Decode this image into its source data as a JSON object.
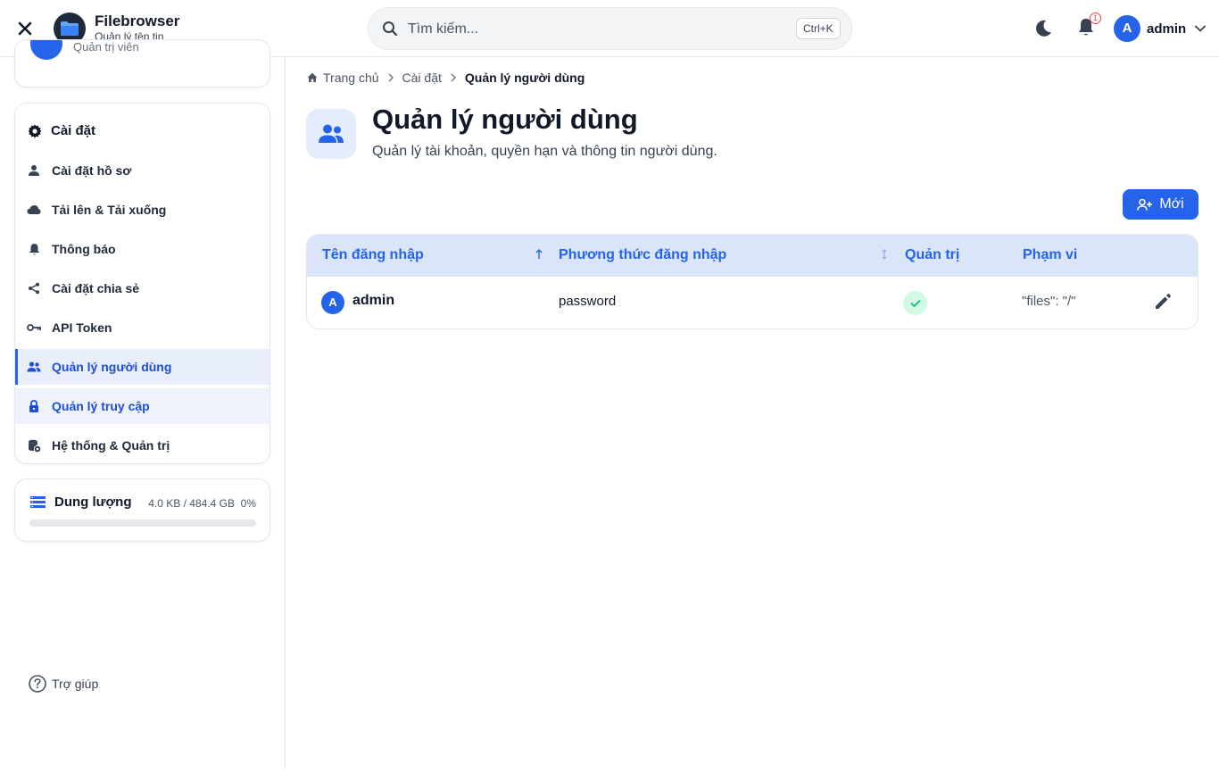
{
  "header": {
    "app_name": "Filebrowser",
    "app_subtitle": "Quản lý tệp tin",
    "search_placeholder": "Tìm kiếm...",
    "search_shortcut": "Ctrl+K",
    "notification_count": "1",
    "user_initial": "A",
    "user_name": "admin"
  },
  "sidebar": {
    "profile_role": "Quản trị viên",
    "settings_title": "Cài đặt",
    "items": [
      {
        "label": "Cài đặt hồ sơ",
        "icon": "user-icon"
      },
      {
        "label": "Tải lên & Tải xuống",
        "icon": "cloud-icon"
      },
      {
        "label": "Thông báo",
        "icon": "bell-icon"
      },
      {
        "label": "Cài đặt chia sẻ",
        "icon": "share-icon"
      },
      {
        "label": "API Token",
        "icon": "key-icon"
      },
      {
        "label": "Quản lý người dùng",
        "icon": "users-icon",
        "active": true
      },
      {
        "label": "Quản lý truy cập",
        "icon": "lock-icon",
        "hover": true
      },
      {
        "label": "Hệ thống & Quản trị",
        "icon": "database-gear-icon"
      }
    ],
    "storage": {
      "label": "Dung lượng",
      "value": "4.0 KB / 484.4 GB",
      "percent": "0%",
      "fill_fraction": 0
    },
    "help_label": "Trợ giúp"
  },
  "main": {
    "breadcrumb": {
      "home": "Trang chủ",
      "settings": "Cài đặt",
      "current": "Quản lý người dùng"
    },
    "title": "Quản lý người dùng",
    "subtitle": "Quản lý tài khoản, quyền hạn và thông tin người dùng.",
    "new_button": "Mới",
    "table": {
      "columns": [
        "Tên đăng nhập",
        "Phương thức đăng nhập",
        "Quản trị",
        "Phạm vi"
      ],
      "rows": [
        {
          "initial": "A",
          "username": "admin",
          "method": "password",
          "admin": true,
          "scope": "\"files\": \"/\""
        }
      ]
    }
  },
  "colors": {
    "accent": "#2563eb",
    "active_bg": "#e8eefc",
    "table_header_bg": "#dbe5fa",
    "success_bg": "#d1fae5",
    "success": "#10b981"
  }
}
